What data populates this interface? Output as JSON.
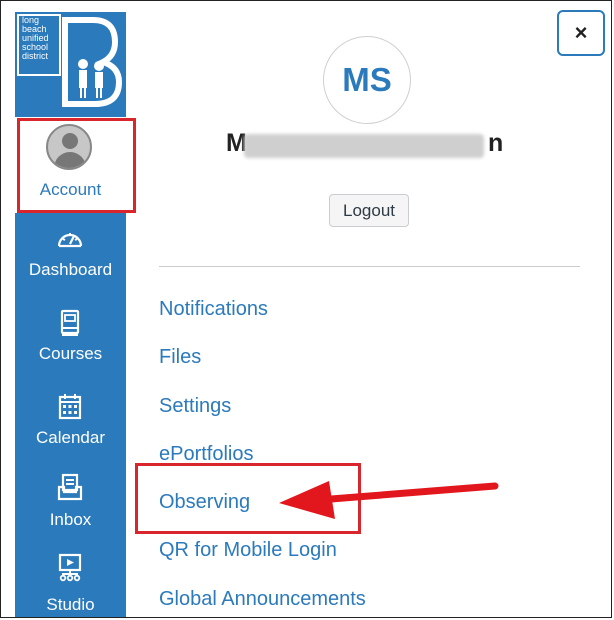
{
  "logo": {
    "lines": [
      "long",
      "beach",
      "unified",
      "school",
      "district"
    ],
    "letter": "B"
  },
  "sidebar": {
    "account_label": "Account",
    "items": [
      {
        "label": "Dashboard",
        "icon": "dashboard-gauge-icon"
      },
      {
        "label": "Courses",
        "icon": "book-icon"
      },
      {
        "label": "Calendar",
        "icon": "calendar-icon"
      },
      {
        "label": "Inbox",
        "icon": "inbox-icon"
      },
      {
        "label": "Studio",
        "icon": "studio-icon"
      }
    ]
  },
  "panel": {
    "close_label": "×",
    "avatar_initials": "MS",
    "user_name_start": "M",
    "user_name_end": "n",
    "logout_label": "Logout",
    "links": [
      "Notifications",
      "Files",
      "Settings",
      "ePortfolios",
      "Observing",
      "QR for Mobile Login",
      "Global Announcements"
    ]
  },
  "colors": {
    "brand": "#2b7abc",
    "annotation": "#d9262c"
  }
}
